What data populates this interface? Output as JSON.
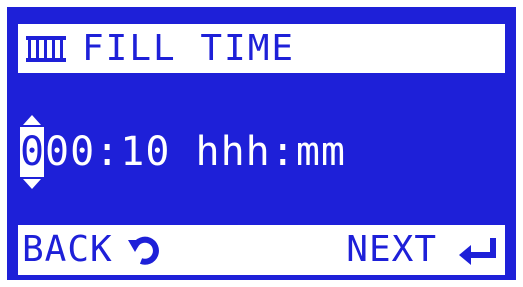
{
  "header": {
    "icon": "tank-fill-icon",
    "title": "FILL TIME"
  },
  "value": {
    "cursor_digit": "0",
    "rest": "00:10 hhh:mm"
  },
  "footer": {
    "back_label": "BACK",
    "back_icon": "rotate-back-icon",
    "next_label": "NEXT",
    "next_icon": "enter-return-icon"
  },
  "colors": {
    "screen_bg": "#1e20d8",
    "text_light": "#ffffff"
  }
}
